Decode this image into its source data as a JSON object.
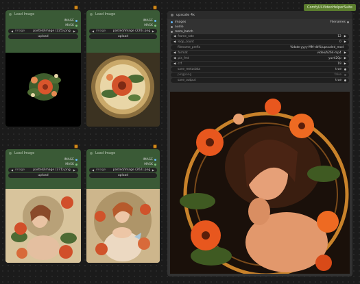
{
  "badge": "ComfyUI-VideoHelperSuite",
  "load_nodes": [
    {
      "title": "Load Image",
      "outputs": [
        "IMAGE",
        "MASK"
      ],
      "image_label": "image",
      "image_value": "pasted/image (225).png",
      "upload_label": "upload"
    },
    {
      "title": "Load Image",
      "outputs": [
        "IMAGE",
        "MASK"
      ],
      "image_label": "image",
      "image_value": "pasted/image (226).png",
      "upload_label": "upload"
    },
    {
      "title": "Load Image",
      "outputs": [
        "IMAGE",
        "MASK"
      ],
      "image_label": "image",
      "image_value": "pasted/image (271).png",
      "upload_label": "upload"
    },
    {
      "title": "Load Image",
      "outputs": [
        "IMAGE",
        "MASK"
      ],
      "image_label": "image",
      "image_value": "pasted/image (262).png",
      "upload_label": "upload"
    }
  ],
  "vhs": {
    "title": "upscale 4x",
    "inputs": [
      "images",
      "audio",
      "meta_batch"
    ],
    "output": "Filenames",
    "widgets": [
      {
        "label": "frame_rate",
        "value": "12"
      },
      {
        "label": "loop_count",
        "value": "0"
      },
      {
        "label": "filename_prefix",
        "value": "%date:yyyy-MM-dd%/upscaled_mod"
      },
      {
        "label": "format",
        "value": "video/h264-mp4"
      },
      {
        "label": "pix_fmt",
        "value": "yuv420p"
      },
      {
        "label": "crf",
        "value": "19"
      },
      {
        "label": "save_metadata",
        "value": "true"
      },
      {
        "label": "pingpong",
        "value": "false"
      },
      {
        "label": "save_output",
        "value": "true"
      }
    ]
  },
  "colors": {
    "node_green": "#3a5a36",
    "pin_orange": "#d08a1c",
    "badge_green": "#5b7d2e"
  }
}
